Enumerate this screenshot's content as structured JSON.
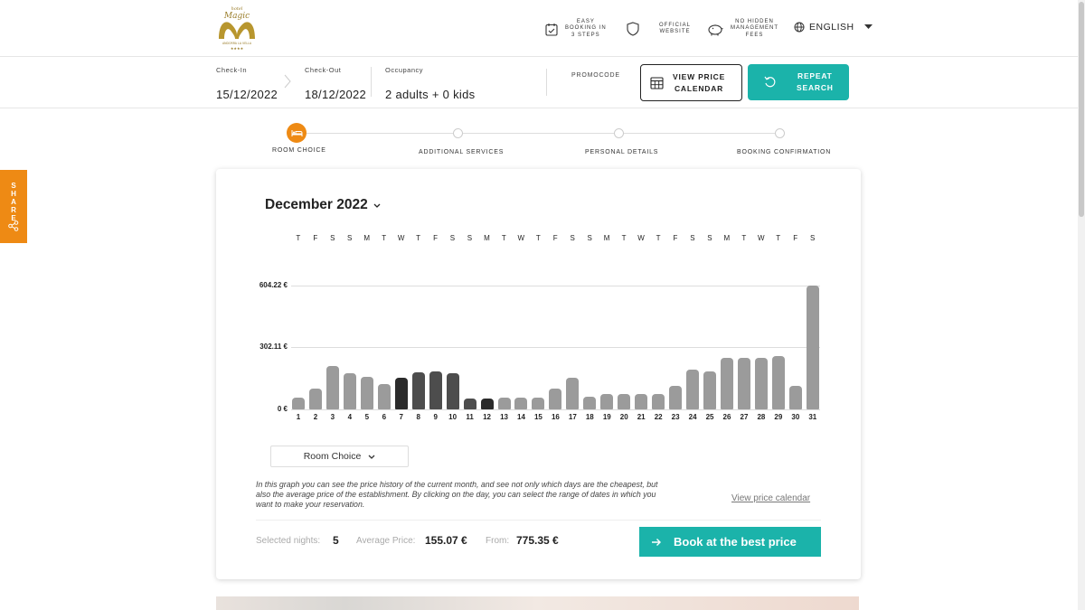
{
  "header": {
    "logo": {
      "line1": "hotel",
      "line2": "Magic",
      "line3": "ANDORRA LA VELLA",
      "stars": "★★★★"
    },
    "features": [
      {
        "icon": "calendar-check-icon",
        "lines": [
          "EASY",
          "BOOKING IN",
          "3 STEPS"
        ]
      },
      {
        "icon": "shield-icon",
        "lines": [
          "OFFICIAL",
          "WEBSITE"
        ]
      },
      {
        "icon": "piggy-bank-icon",
        "lines": [
          "NO HIDDEN",
          "MANAGEMENT",
          "FEES"
        ]
      }
    ],
    "language": "ENGLISH"
  },
  "search": {
    "checkin_label": "Check-In",
    "checkin_value": "15/12/2022",
    "checkout_label": "Check-Out",
    "checkout_value": "18/12/2022",
    "occupancy_label": "Occupancy",
    "occupancy_value": "2 adults + 0 kids",
    "promocode_label": "PROMOCODE",
    "calendar_btn": [
      "VIEW PRICE",
      "CALENDAR"
    ],
    "repeat_btn": [
      "REPEAT",
      "SEARCH"
    ]
  },
  "share": {
    "label": "SHARE"
  },
  "steps": [
    {
      "label": "ROOM CHOICE",
      "active": true
    },
    {
      "label": "ADDITIONAL SERVICES",
      "active": false
    },
    {
      "label": "PERSONAL DETAILS",
      "active": false
    },
    {
      "label": "BOOKING CONFIRMATION",
      "active": false
    }
  ],
  "calendar": {
    "month": "December 2022",
    "room_select": "Room Choice",
    "description": "In this graph you can see the price history of the current month, and see not only which days are the cheapest, but also the average price of the establishment. By clicking on the day, you can select the range of dates in which you want to make your reservation.",
    "view_link": "View price calendar",
    "selected_nights_label": "Selected nights:",
    "selected_nights_value": "5",
    "average_label": "Average Price:",
    "average_value": "155.07 €",
    "from_label": "From:",
    "from_value": "775.35 €",
    "book_btn": "Book at the best price"
  },
  "chart_data": {
    "type": "bar",
    "title": "",
    "xlabel": "",
    "ylabel": "",
    "ylim": [
      0,
      604.22
    ],
    "yticks": [
      "0 €",
      "302.11 €",
      "604.22 €"
    ],
    "weekdays": [
      "T",
      "F",
      "S",
      "S",
      "M",
      "T",
      "W",
      "T",
      "F",
      "S",
      "S",
      "M",
      "T",
      "W",
      "T",
      "F",
      "S",
      "S",
      "M",
      "T",
      "W",
      "T",
      "F",
      "S",
      "S",
      "M",
      "T",
      "W",
      "T",
      "F",
      "S"
    ],
    "categories": [
      "1",
      "2",
      "3",
      "4",
      "5",
      "6",
      "7",
      "8",
      "9",
      "10",
      "11",
      "12",
      "13",
      "14",
      "15",
      "16",
      "17",
      "18",
      "19",
      "20",
      "21",
      "22",
      "23",
      "24",
      "25",
      "26",
      "27",
      "28",
      "29",
      "30",
      "31"
    ],
    "values": [
      56,
      102,
      213,
      178,
      160,
      124,
      155,
      180,
      186,
      177,
      54,
      54,
      56,
      56,
      56,
      100,
      155,
      62,
      75,
      75,
      75,
      75,
      115,
      195,
      185,
      250,
      250,
      250,
      260,
      115,
      604
    ],
    "selected_days": [
      7,
      8,
      9,
      10,
      11,
      12
    ],
    "lowest_day": 12,
    "grid": true
  }
}
